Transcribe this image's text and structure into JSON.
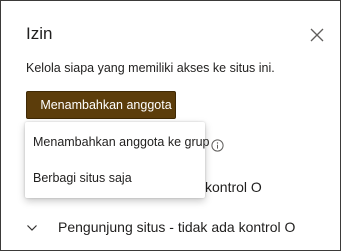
{
  "panel": {
    "title": "Izin",
    "description": "Kelola siapa yang memiliki akses ke situs ini.",
    "close_icon": "close-icon"
  },
  "add_button": {
    "label": "Menambahkan anggota"
  },
  "dropdown": {
    "items": [
      {
        "label": "Menambahkan anggota ke grup"
      },
      {
        "label": "Berbagi situs saja"
      }
    ]
  },
  "groups": {
    "row1_partial": "l",
    "row2_partial": "kontrol O",
    "row3_label": "Pengunjung situs - tidak ada kontrol O"
  },
  "colors": {
    "accent": "#5c3d0b",
    "text": "#201f1e",
    "border": "#3b3a39"
  },
  "icons": [
    "close-icon",
    "info-icon",
    "chevron-down-icon"
  ]
}
